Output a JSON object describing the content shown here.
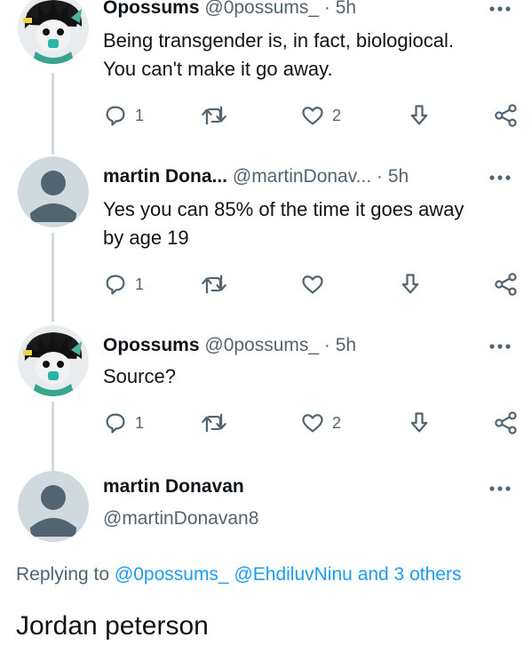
{
  "tweets": [
    {
      "name": "Opossums",
      "meta": "@0possums_ · 5h",
      "text_lines": [
        "Being transgender is, in fact, biologiocal.",
        "You can't make it go away."
      ],
      "reply_count": "1",
      "retweet_count": "",
      "like_count": "2"
    },
    {
      "name": "martin Dona...",
      "meta": "@martinDonav... · 5h",
      "text_lines": [
        "Yes you can 85% of the time it goes away",
        "by age 19"
      ],
      "reply_count": "1",
      "retweet_count": "",
      "like_count": ""
    },
    {
      "name": "Opossums",
      "meta": "@0possums_ · 5h",
      "text_lines": [
        "Source?"
      ],
      "reply_count": "1",
      "retweet_count": "",
      "like_count": "2"
    }
  ],
  "main_tweet": {
    "name": "martin Donavan",
    "handle": "@martinDonavan8",
    "replying_prefix": "Replying to",
    "replying_mentions": "@0possums_ @EhdiluvNinu",
    "replying_suffix": "and 3 others",
    "text": "Jordan peterson"
  },
  "icons": {
    "reply": "reply-icon",
    "retweet": "retweet-icon",
    "like": "heart-icon",
    "download": "download-icon",
    "share": "share-icon",
    "more": "more-icon"
  },
  "colors": {
    "text": "#0f1419",
    "muted": "#536471",
    "link": "#1d9bf0",
    "thread_line": "#cfd9de",
    "default_avatar_bg": "#cfd9de",
    "default_avatar_fg": "#ffffff"
  }
}
